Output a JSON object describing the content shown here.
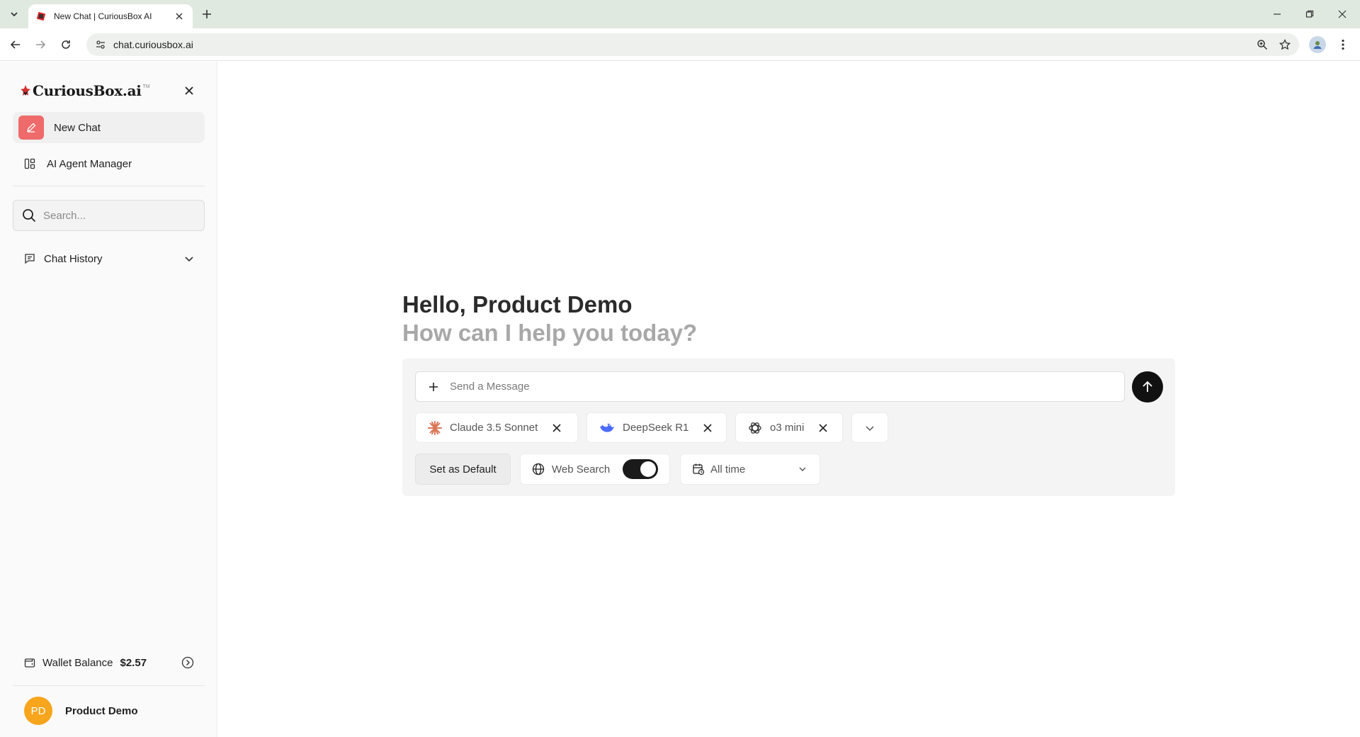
{
  "browser": {
    "tab_title": "New Chat | CuriousBox AI",
    "url": "chat.curiousbox.ai",
    "icons": [
      "tab-list-icon",
      "close-icon",
      "plus-icon",
      "minimize-icon",
      "restore-icon",
      "back-icon",
      "forward-icon",
      "reload-icon",
      "site-info-icon",
      "zoom-icon",
      "star-icon",
      "profile-icon",
      "more-vert-icon"
    ]
  },
  "sidebar": {
    "brand": "CuriousBox.ai",
    "brand_tm": "TM",
    "new_chat": "New Chat",
    "agent_manager": "AI Agent Manager",
    "search_placeholder": "Search...",
    "chat_history": "Chat History",
    "wallet_label": "Wallet Balance",
    "wallet_amount": "$2.57",
    "user_initials": "PD",
    "user_name": "Product Demo"
  },
  "main": {
    "greeting": "Hello, Product Demo",
    "subgreeting": "How can I help you today?",
    "message_placeholder": "Send a Message",
    "models": [
      {
        "label": "Claude 3.5 Sonnet",
        "icon": "claude-icon"
      },
      {
        "label": "DeepSeek R1",
        "icon": "deepseek-icon"
      },
      {
        "label": "o3 mini",
        "icon": "openai-icon"
      }
    ],
    "set_default": "Set as Default",
    "web_search": "Web Search",
    "web_search_on": true,
    "time_filter": "All time"
  },
  "colors": {
    "accent_new_chat": "#ef6b6b",
    "avatar": "#f7a51c",
    "send_button": "#111111"
  }
}
